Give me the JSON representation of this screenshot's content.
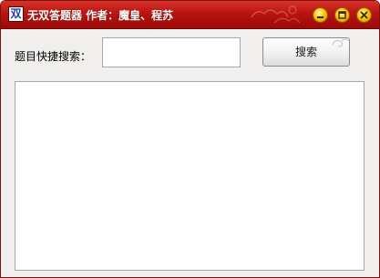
{
  "window": {
    "title": "无双答题器 作者：魔皇、程苏",
    "icon_char": "双",
    "icon_name": "app-logo-icon",
    "controls": {
      "minimize_icon": "minimize-icon",
      "maximize_icon": "maximize-icon",
      "close_icon": "close-icon"
    }
  },
  "search": {
    "label": "题目快捷搜索：",
    "value": "",
    "placeholder": "",
    "button_label": "搜索"
  },
  "results": {
    "value": ""
  },
  "colors": {
    "titlebar": "#b91410",
    "window_bg": "#f0efed",
    "control_buttons": "#f5c400"
  }
}
